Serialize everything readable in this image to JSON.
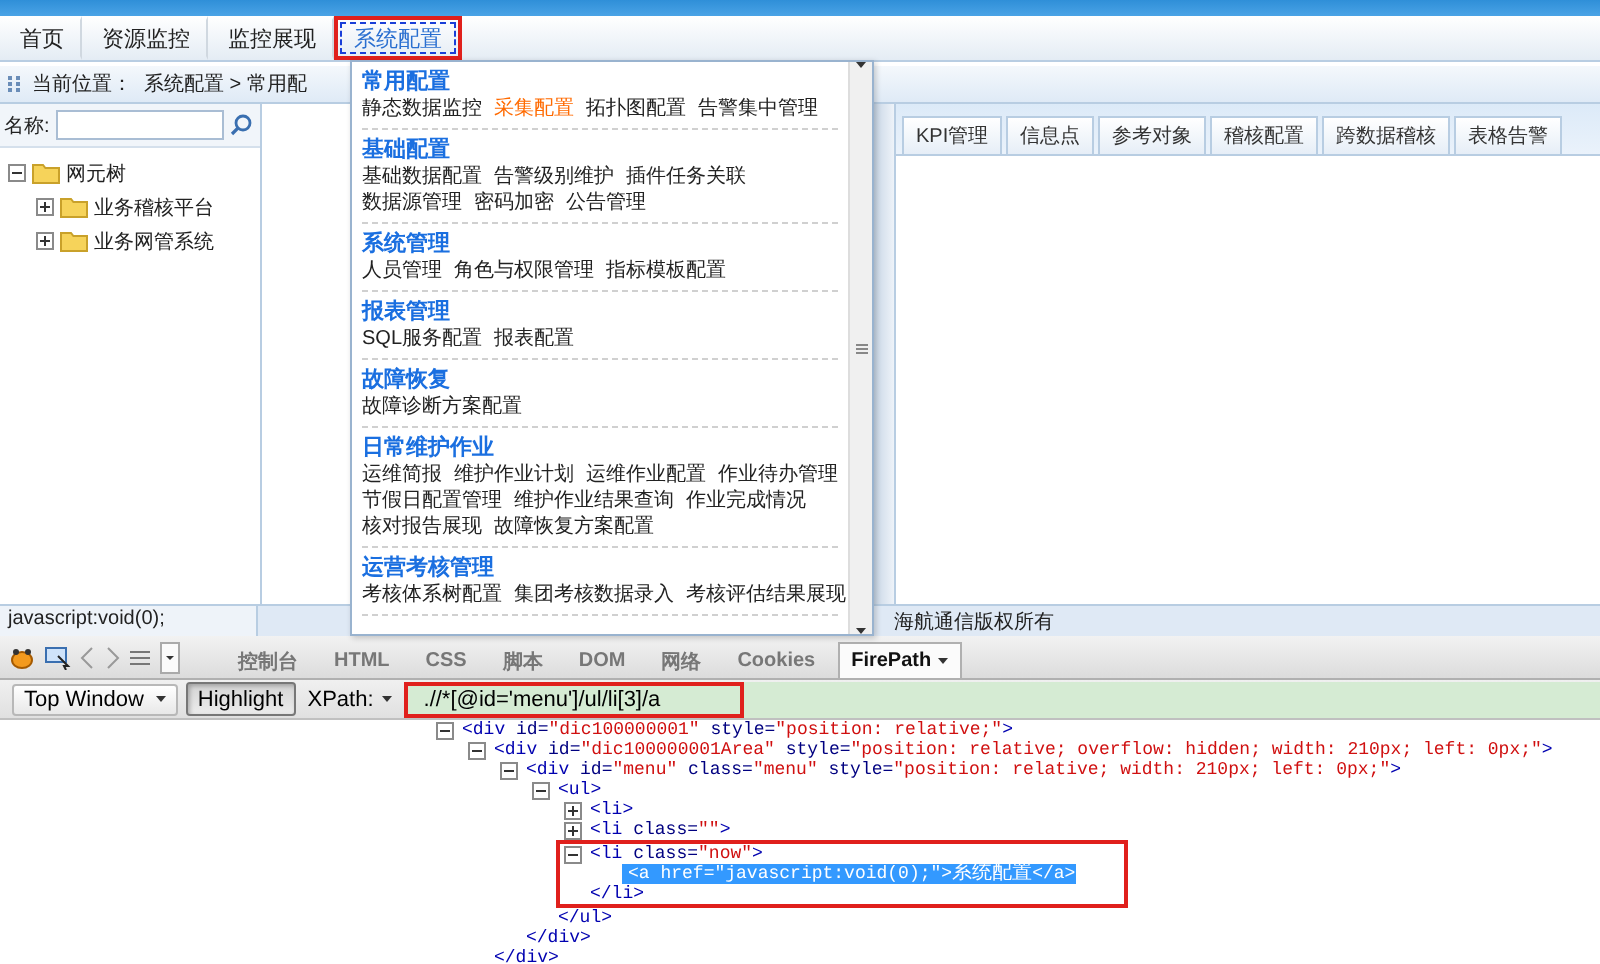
{
  "nav": {
    "items": [
      {
        "label": "首页",
        "selected": false,
        "annotated": false
      },
      {
        "label": "资源监控",
        "selected": false,
        "annotated": false
      },
      {
        "label": "监控展现",
        "selected": false,
        "annotated": false
      },
      {
        "label": "系统配置",
        "selected": true,
        "annotated": true
      }
    ]
  },
  "breadcrumb": {
    "label": "当前位置：",
    "path": "系统配置 > 常用配"
  },
  "left_panel": {
    "search_label": "名称:",
    "tree": [
      {
        "label": "网元树",
        "expanded": true,
        "children": [
          {
            "label": "业务稽核平台",
            "expanded": false
          },
          {
            "label": "业务网管系统",
            "expanded": false
          }
        ]
      }
    ]
  },
  "tabs": [
    {
      "label": "KPI管理",
      "selected": false
    },
    {
      "label": "信息点",
      "selected": false
    },
    {
      "label": "参考对象",
      "selected": false
    },
    {
      "label": "稽核配置",
      "selected": false
    },
    {
      "label": "跨数据稽核",
      "selected": false
    },
    {
      "label": "表格告警",
      "selected": false
    }
  ],
  "menu": {
    "sections": [
      {
        "title": "常用配置",
        "rows": [
          [
            {
              "label": "静态数据监控",
              "highlighted": false
            },
            {
              "label": "采集配置",
              "highlighted": true
            },
            {
              "label": "拓扑图配置",
              "highlighted": false
            },
            {
              "label": "告警集中管理",
              "highlighted": false
            }
          ]
        ]
      },
      {
        "title": "基础配置",
        "rows": [
          [
            {
              "label": "基础数据配置",
              "highlighted": false
            },
            {
              "label": "告警级别维护",
              "highlighted": false
            },
            {
              "label": "插件任务关联",
              "highlighted": false
            }
          ],
          [
            {
              "label": "数据源管理",
              "highlighted": false
            },
            {
              "label": "密码加密",
              "highlighted": false
            },
            {
              "label": "公告管理",
              "highlighted": false
            }
          ]
        ]
      },
      {
        "title": "系统管理",
        "rows": [
          [
            {
              "label": "人员管理",
              "highlighted": false
            },
            {
              "label": "角色与权限管理",
              "highlighted": false
            },
            {
              "label": "指标模板配置",
              "highlighted": false
            }
          ]
        ]
      },
      {
        "title": "报表管理",
        "rows": [
          [
            {
              "label": "SQL服务配置",
              "highlighted": false
            },
            {
              "label": "报表配置",
              "highlighted": false
            }
          ]
        ]
      },
      {
        "title": "故障恢复",
        "rows": [
          [
            {
              "label": "故障诊断方案配置",
              "highlighted": false
            }
          ]
        ]
      },
      {
        "title": "日常维护作业",
        "rows": [
          [
            {
              "label": "运维简报",
              "highlighted": false
            },
            {
              "label": "维护作业计划",
              "highlighted": false
            },
            {
              "label": "运维作业配置",
              "highlighted": false
            },
            {
              "label": "作业待办管理",
              "highlighted": false
            }
          ],
          [
            {
              "label": "节假日配置管理",
              "highlighted": false
            },
            {
              "label": "维护作业结果查询",
              "highlighted": false
            },
            {
              "label": "作业完成情况",
              "highlighted": false
            }
          ],
          [
            {
              "label": "核对报告展现",
              "highlighted": false
            },
            {
              "label": "故障恢复方案配置",
              "highlighted": false
            }
          ]
        ]
      },
      {
        "title": "运营考核管理",
        "rows": [
          [
            {
              "label": "考核体系树配置",
              "highlighted": false
            },
            {
              "label": "集团考核数据录入",
              "highlighted": false
            },
            {
              "label": "考核评估结果展现",
              "highlighted": false
            }
          ]
        ]
      }
    ]
  },
  "status_bar": {
    "url": "javascript:void(0);",
    "copyright": "海航通信版权所有"
  },
  "devtools": {
    "tabs": [
      {
        "label": "控制台",
        "selected": false
      },
      {
        "label": "HTML",
        "selected": false
      },
      {
        "label": "CSS",
        "selected": false
      },
      {
        "label": "脚本",
        "selected": false
      },
      {
        "label": "DOM",
        "selected": false
      },
      {
        "label": "网络",
        "selected": false
      },
      {
        "label": "Cookies",
        "selected": false
      },
      {
        "label": "FirePath",
        "selected": true
      }
    ],
    "window_select": "Top Window",
    "highlight": {
      "label": "Highlight",
      "pressed": true
    },
    "xpath": {
      "label": "XPath:",
      "value": ".//*[@id='menu']/ul/li[3]/a",
      "annotated": true
    },
    "dom": [
      {
        "open": "<div",
        "attrs": [
          {
            "name": "id=",
            "value": "\"dic100000001\""
          },
          {
            "name": "style=",
            "value": "\"position: relative;\""
          }
        ],
        "end": ">",
        "expanded": true,
        "selected": false,
        "annotated": false,
        "children": [
          {
            "open": "<div",
            "attrs": [
              {
                "name": "id=",
                "value": "\"dic100000001Area\""
              },
              {
                "name": "style=",
                "value": "\"position: relative; overflow: hidden; width: 210px; left: 0px;\""
              }
            ],
            "end": ">",
            "close": "</div>",
            "expanded": true,
            "selected": false,
            "annotated": false,
            "children": [
              {
                "open": "<div",
                "attrs": [
                  {
                    "name": "id=",
                    "value": "\"menu\""
                  },
                  {
                    "name": "class=",
                    "value": "\"menu\""
                  },
                  {
                    "name": "style=",
                    "value": "\"position: relative; width: 210px; left: 0px;\""
                  }
                ],
                "end": ">",
                "close": "</div>",
                "expanded": true,
                "selected": false,
                "annotated": false,
                "children": [
                  {
                    "open": "<ul",
                    "end": ">",
                    "close": "</ul>",
                    "expanded": true,
                    "selected": false,
                    "annotated": false,
                    "children": [
                      {
                        "open": "<li",
                        "end": ">",
                        "expanded": false,
                        "selected": false,
                        "annotated": false
                      },
                      {
                        "open": "<li",
                        "attrs": [
                          {
                            "name": "class=",
                            "value": "\"\""
                          }
                        ],
                        "end": ">",
                        "expanded": false,
                        "selected": false,
                        "annotated": false
                      },
                      {
                        "open": "<li",
                        "attrs": [
                          {
                            "name": "class=",
                            "value": "\"now\""
                          }
                        ],
                        "end": ">",
                        "close": "</li>",
                        "expanded": true,
                        "selected": false,
                        "annotated": true,
                        "children": [
                          {
                            "open": "<a",
                            "attrs": [
                              {
                                "name": "href=",
                                "value": "\"javascript:void(0);\""
                              }
                            ],
                            "end": ">",
                            "text": "系统配置",
                            "close": "</a>",
                            "selected": true,
                            "annotated": false
                          }
                        ]
                      }
                    ]
                  }
                ]
              }
            ]
          }
        ]
      }
    ]
  }
}
